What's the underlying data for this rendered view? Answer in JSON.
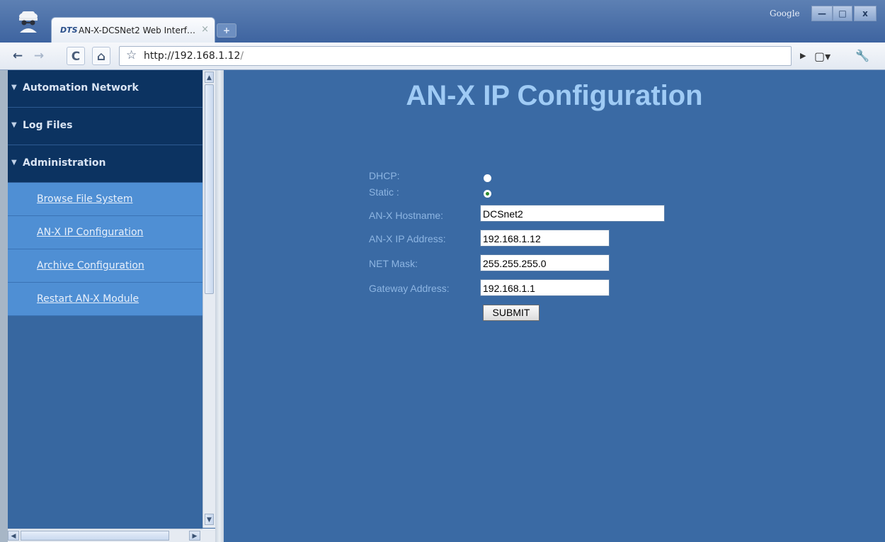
{
  "browser": {
    "tab_title": "AN-X-DCSNet2 Web Interf…",
    "tab_favicon": "DTS",
    "url_host": "http://192.168.1.12",
    "url_path": "/",
    "google_label": "Google",
    "icons": [
      "back-icon",
      "forward-icon",
      "reload-icon",
      "home-icon",
      "star-icon",
      "page-menu-icon",
      "wrench-icon"
    ]
  },
  "sidebar": {
    "groups": [
      {
        "label": "Automation Network"
      },
      {
        "label": "Log Files"
      },
      {
        "label": "Administration"
      }
    ],
    "items": [
      {
        "label": "Browse File System"
      },
      {
        "label": "AN-X IP Configuration"
      },
      {
        "label": "Archive Configuration"
      },
      {
        "label": "Restart AN-X Module"
      }
    ]
  },
  "form": {
    "title": "AN-X IP Configuration",
    "dhcp_label": "DHCP:",
    "static_label": "Static :",
    "selected_mode": "Static",
    "hostname_label": "AN-X Hostname:",
    "hostname_value": "DCSnet2",
    "ip_label": "AN-X IP Address:",
    "ip_value": "192.168.1.12",
    "mask_label": "NET Mask:",
    "mask_value": "255.255.255.0",
    "gateway_label": "Gateway Address:",
    "gateway_value": "192.168.1.1",
    "submit_label": "SUBMIT"
  },
  "colors": {
    "content_bg": "#3a6aa4",
    "nav_header_bg": "#0c3361",
    "nav_item_bg": "#4f8fd4",
    "title_color": "#9fcbf5"
  }
}
